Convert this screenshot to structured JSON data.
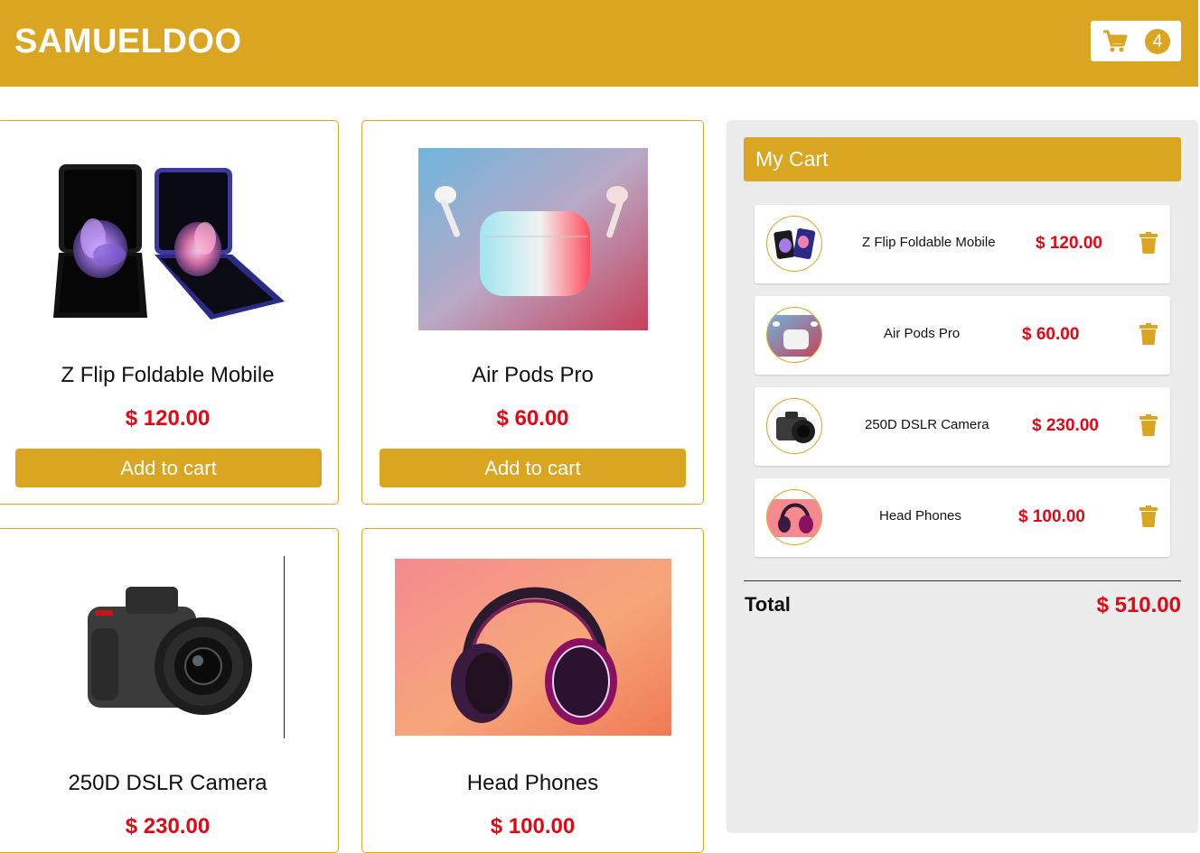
{
  "header": {
    "brand": "SAMUELDOO",
    "cart_count": "4",
    "bg_color": "#daa520"
  },
  "products": [
    {
      "name": "Z Flip Foldable Mobile",
      "price": "$ 120.00",
      "button": "Add to cart"
    },
    {
      "name": "Air Pods Pro",
      "price": "$ 60.00",
      "button": "Add to cart"
    },
    {
      "name": "250D DSLR Camera",
      "price": "$ 230.00"
    },
    {
      "name": "Head Phones",
      "price": "$ 100.00"
    }
  ],
  "cart": {
    "title": "My Cart",
    "items": [
      {
        "name": "Z Flip Foldable Mobile",
        "price": "$ 120.00"
      },
      {
        "name": "Air Pods Pro",
        "price": "$ 60.00"
      },
      {
        "name": "250D DSLR Camera",
        "price": "$ 230.00"
      },
      {
        "name": "Head Phones",
        "price": "$ 100.00"
      }
    ],
    "total_label": "Total",
    "total_value": "$ 510.00"
  },
  "colors": {
    "accent": "#daa520",
    "price": "#e30613",
    "panel": "#ececec"
  },
  "icons": {
    "cart": "cart-icon",
    "delete": "trash-icon"
  }
}
